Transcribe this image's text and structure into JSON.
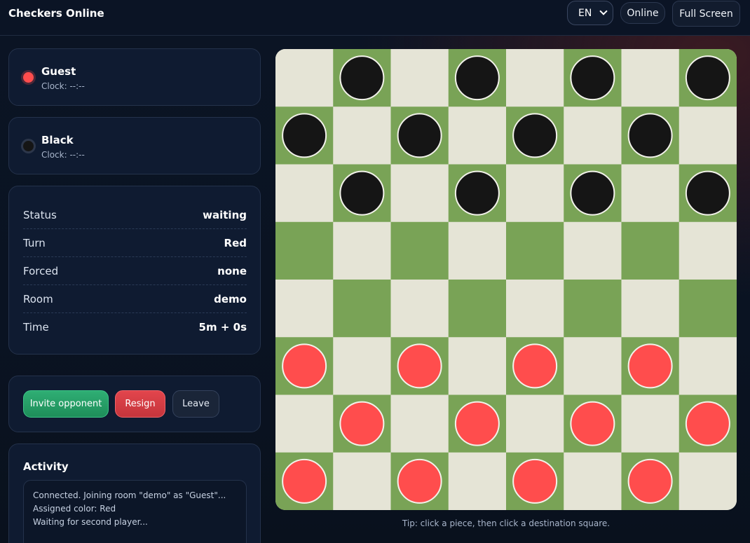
{
  "header": {
    "title": "Checkers Online",
    "language": "EN",
    "online_label": "Online",
    "fullscreen_label": "Full Screen"
  },
  "players": [
    {
      "name": "Guest",
      "clock": "Clock: --:--",
      "color": "#ff4d4d"
    },
    {
      "name": "Black",
      "clock": "Clock: --:--",
      "color": "#151515"
    }
  ],
  "status": {
    "rows": [
      {
        "key": "Status",
        "value": "waiting"
      },
      {
        "key": "Turn",
        "value": "Red"
      },
      {
        "key": "Forced",
        "value": "none"
      },
      {
        "key": "Room",
        "value": "demo"
      },
      {
        "key": "Time",
        "value": "5m + 0s"
      }
    ]
  },
  "actions": {
    "invite_label": "Invite opponent",
    "resign_label": "Resign",
    "leave_label": "Leave"
  },
  "activity": {
    "title": "Activity",
    "log": [
      "Connected. Joining room \"demo\" as \"Guest\"...",
      "Assigned color: Red",
      "Waiting for second player..."
    ]
  },
  "board": {
    "size": 8,
    "light_color": "#e5e4d6",
    "dark_color": "#79a356",
    "rows": [
      ".b.b.b.b",
      "b.b.b.b.",
      ".b.b.b.b",
      "........",
      "........",
      "r.r.r.r.",
      ".r.r.r.r",
      "r.r.r.r."
    ],
    "tip": "Tip: click a piece, then click a destination square."
  }
}
